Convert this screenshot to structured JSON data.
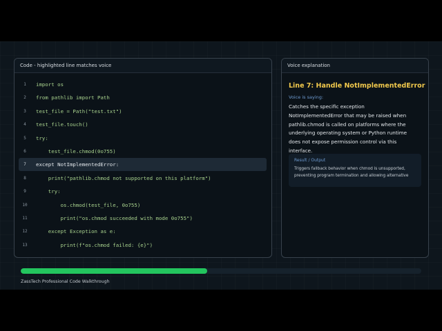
{
  "code_panel": {
    "title": "Code - highlighted line matches voice",
    "active_line": 7,
    "lines": [
      {
        "num": "1",
        "code": "import os"
      },
      {
        "num": "2",
        "code": "from pathlib import Path"
      },
      {
        "num": "3",
        "code": "test_file = Path(\"test.txt\")"
      },
      {
        "num": "4",
        "code": "test_file.touch()"
      },
      {
        "num": "5",
        "code": "try:"
      },
      {
        "num": "6",
        "code": "    test_file.chmod(0o755)"
      },
      {
        "num": "7",
        "code": "except NotImplementedError:"
      },
      {
        "num": "8",
        "code": "    print(\"pathlib.chmod not supported on this platform\")"
      },
      {
        "num": "9",
        "code": "    try:"
      },
      {
        "num": "10",
        "code": "        os.chmod(test_file, 0o755)"
      },
      {
        "num": "11",
        "code": "        print(\"os.chmod succeeded with mode 0o755\")"
      },
      {
        "num": "12",
        "code": "    except Exception as e:"
      },
      {
        "num": "13",
        "code": "        print(f\"os.chmod failed: {e}\")"
      }
    ]
  },
  "voice_panel": {
    "title": "Voice explanation",
    "heading": "Line 7: Handle NotImplementedError",
    "saying_label": "Voice is saying:",
    "body": "Catches the specific exception NotImplementedError that may be raised when pathlib.chmod is called on platforms where the underlying operating system or Python runtime does not expose permission control via this interface.",
    "result": {
      "title": "Result / Output",
      "text": "Triggers fallback behavior when chmod is unsupported, preventing program termination and allowing alternative"
    }
  },
  "progress": {
    "fraction": 0.465
  },
  "footer": {
    "brand": "ZassTech Professional Code Walkthrough"
  },
  "colors": {
    "accent_heading": "#f2c94c",
    "progress": "#23c55e",
    "code_text": "#a9d38e",
    "label_blue": "#6e9bd1"
  }
}
